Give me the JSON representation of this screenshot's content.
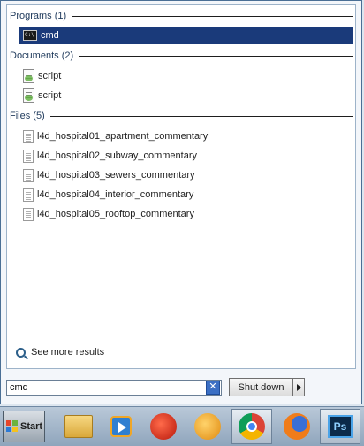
{
  "groups": {
    "programs": {
      "label": "Programs (1)",
      "items": [
        {
          "label": "cmd",
          "icon": "cmd-icon"
        }
      ]
    },
    "documents": {
      "label": "Documents (2)",
      "items": [
        {
          "label": "script",
          "icon": "script-icon"
        },
        {
          "label": "script",
          "icon": "script-icon"
        }
      ]
    },
    "files": {
      "label": "Files (5)",
      "items": [
        {
          "label": "l4d_hospital01_apartment_commentary",
          "icon": "text-file-icon"
        },
        {
          "label": "l4d_hospital02_subway_commentary",
          "icon": "text-file-icon"
        },
        {
          "label": "l4d_hospital03_sewers_commentary",
          "icon": "text-file-icon"
        },
        {
          "label": "l4d_hospital04_interior_commentary",
          "icon": "text-file-icon"
        },
        {
          "label": "l4d_hospital05_rooftop_commentary",
          "icon": "text-file-icon"
        }
      ]
    }
  },
  "see_more": "See more results",
  "search": {
    "value": "cmd",
    "clear": "✕"
  },
  "shutdown": {
    "label": "Shut down"
  },
  "taskbar": {
    "start_label": "Start",
    "items": [
      {
        "name": "explorer",
        "icon": "folder-icon"
      },
      {
        "name": "media-player",
        "icon": "media-player-icon"
      },
      {
        "name": "ccleaner",
        "icon": "ccleaner-icon"
      },
      {
        "name": "app-orange",
        "icon": "orange-app-icon"
      },
      {
        "name": "chrome",
        "icon": "chrome-icon"
      },
      {
        "name": "firefox",
        "icon": "firefox-icon"
      },
      {
        "name": "photoshop",
        "icon": "photoshop-icon",
        "label": "Ps"
      }
    ]
  },
  "colors": {
    "selection": "#1a3a7a",
    "accent": "#3b6fc4"
  }
}
